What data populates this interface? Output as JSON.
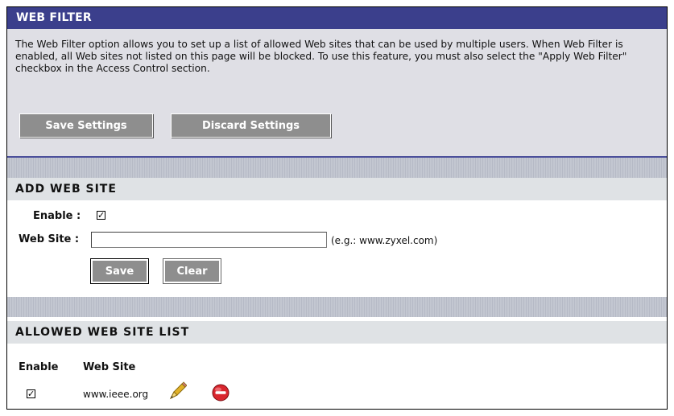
{
  "web_filter": {
    "title": "WEB FILTER",
    "description": "The Web Filter option allows you to set up a list of allowed Web sites that can be used by multiple users. When Web Filter is enabled, all Web sites not listed on this page will be blocked. To use this feature, you must also select the \"Apply Web Filter\" checkbox in the Access Control section.",
    "save_settings_label": "Save Settings",
    "discard_settings_label": "Discard Settings"
  },
  "add_web_site": {
    "title": "ADD WEB SITE",
    "enable_label": "Enable :",
    "enable_checked": true,
    "website_label": "Web Site :",
    "website_value": "",
    "example_hint": "(e.g.: www.zyxel.com)",
    "save_label": "Save",
    "clear_label": "Clear"
  },
  "allowed_list": {
    "title": "ALLOWED WEB SITE LIST",
    "columns": [
      "Enable",
      "Web Site"
    ],
    "rows": [
      {
        "enabled": true,
        "website": "www.ieee.org",
        "actions": [
          "edit-pencil-icon",
          "delete-icon"
        ]
      }
    ]
  },
  "colors": {
    "header_bg": "#3b3f8c",
    "panel_bg": "#dfdfe5",
    "button_bg": "#8e8e8e",
    "delete_red": "#d9262e",
    "pencil_yellow": "#e2b227"
  }
}
